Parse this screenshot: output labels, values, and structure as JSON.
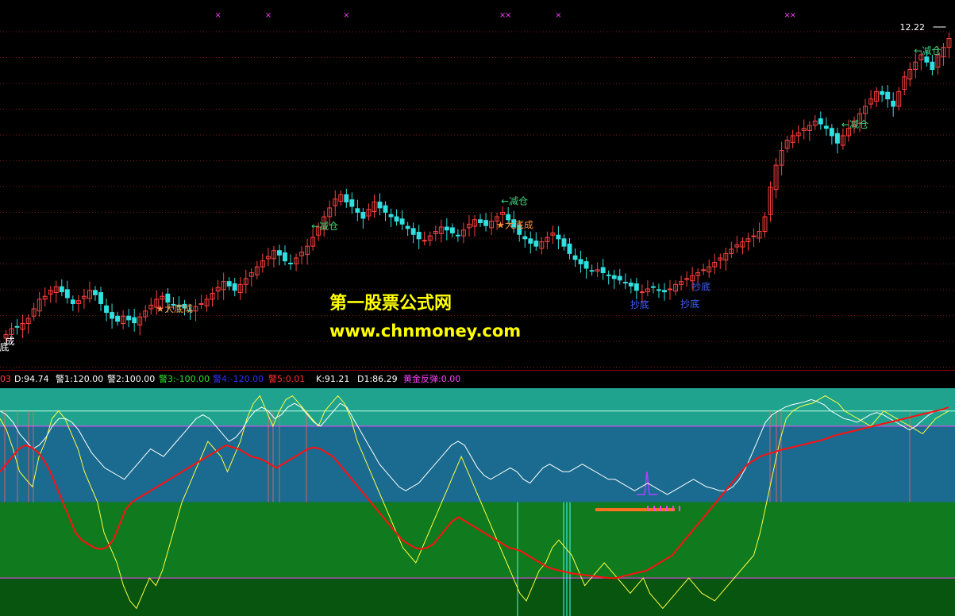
{
  "colors": {
    "background": "#000000",
    "grid": "#7a1a1a",
    "candle_up": "#ff4040",
    "candle_down": "#30e0e0",
    "signal_text": "#3cd67a",
    "star_text": "#ff9040",
    "bottom_text": "#4060ff",
    "watermark": "#ffff00",
    "zone_teal": "#1fa38f",
    "zone_blue": "#1a6b8f",
    "zone_green": "#0f7a1e",
    "zone_dark_green": "#085510",
    "kline": "#ffff40",
    "dline": "#ffffff",
    "slow_line": "#ff1010",
    "pulse": "#b040ff",
    "bar_orange": "#ff7020",
    "bar_magenta": "#ff40ff"
  },
  "watermark": {
    "line1": "第一股票公式网",
    "line2": "www.chnmoney.com"
  },
  "indicator_bar": {
    "items": [
      {
        "text": "03",
        "color": "#ff4040"
      },
      {
        "text": "D:94.74",
        "color": "#ffffff"
      },
      {
        "text": "警1:120.00",
        "color": "#ffffff"
      },
      {
        "text": "警2:100.00",
        "color": "#ffffff"
      },
      {
        "text": "警3:-100.00",
        "color": "#30e030"
      },
      {
        "text": "警4:-120.00",
        "color": "#3030ff"
      },
      {
        "text": "警5:0.01",
        "color": "#ff3030"
      },
      {
        "text": "K:91.21",
        "color": "#ffffff"
      },
      {
        "text": "D1:86.29",
        "color": "#ffffff"
      },
      {
        "text": "黄金反弹:0.00",
        "color": "#ff40ff"
      }
    ]
  },
  "chart_data": [
    {
      "type": "candlestick",
      "title": "",
      "price_label": "12.22",
      "annotations": [
        {
          "text": "底",
          "index": 0
        },
        {
          "text": "成",
          "index": 1
        },
        {
          "text": "★大底成",
          "index": 28
        },
        {
          "text": "←减仓",
          "index": 55
        },
        {
          "text": "←减仓",
          "index": 89
        },
        {
          "text": "★大底成",
          "index": 89
        },
        {
          "text": "抄底",
          "index": 113
        },
        {
          "text": "抄底",
          "index": 122
        },
        {
          "text": "抄底",
          "index": 124
        },
        {
          "text": "←减仓",
          "index": 150
        },
        {
          "text": "←减仓",
          "index": 163
        }
      ],
      "top_markers_index": [
        38,
        47,
        61,
        89,
        90,
        99,
        140,
        141
      ],
      "closes": [
        8.2,
        8.28,
        8.3,
        8.35,
        8.42,
        8.55,
        8.68,
        8.72,
        8.8,
        8.85,
        8.78,
        8.7,
        8.62,
        8.66,
        8.72,
        8.8,
        8.74,
        8.62,
        8.5,
        8.42,
        8.38,
        8.45,
        8.4,
        8.36,
        8.44,
        8.52,
        8.6,
        8.68,
        8.72,
        8.64,
        8.6,
        8.58,
        8.56,
        8.52,
        8.58,
        8.62,
        8.68,
        8.76,
        8.84,
        8.92,
        8.86,
        8.8,
        8.88,
        8.96,
        9.04,
        9.12,
        9.2,
        9.26,
        9.34,
        9.28,
        9.2,
        9.16,
        9.24,
        9.32,
        9.4,
        9.52,
        9.66,
        9.8,
        9.92,
        10.04,
        10.1,
        10.0,
        9.94,
        9.86,
        9.78,
        9.9,
        10.0,
        9.92,
        9.86,
        9.8,
        9.74,
        9.7,
        9.64,
        9.56,
        9.5,
        9.48,
        9.54,
        9.6,
        9.66,
        9.62,
        9.58,
        9.54,
        9.62,
        9.7,
        9.76,
        9.72,
        9.68,
        9.74,
        9.8,
        9.86,
        9.76,
        9.66,
        9.56,
        9.5,
        9.44,
        9.4,
        9.46,
        9.52,
        9.58,
        9.5,
        9.4,
        9.3,
        9.22,
        9.16,
        9.1,
        9.06,
        9.08,
        9.04,
        9.0,
        8.96,
        8.94,
        8.9,
        8.86,
        8.8,
        8.78,
        8.82,
        8.84,
        8.8,
        8.78,
        8.82,
        8.88,
        8.92,
        8.96,
        9.0,
        9.04,
        9.08,
        9.12,
        9.18,
        9.24,
        9.3,
        9.36,
        9.42,
        9.46,
        9.5,
        9.54,
        9.6,
        9.8,
        10.2,
        10.5,
        10.7,
        10.84,
        10.9,
        10.94,
        11.0,
        11.04,
        11.1,
        11.06,
        11.0,
        10.9,
        10.8,
        10.9,
        11.0,
        11.1,
        11.2,
        11.3,
        11.4,
        11.5,
        11.46,
        11.4,
        11.3,
        11.5,
        11.7,
        11.8,
        11.9,
        12.0,
        11.9,
        11.8,
        12.0,
        12.1,
        12.22
      ]
    },
    {
      "type": "line",
      "title": "",
      "ylim": [
        -150,
        150
      ],
      "zones": [
        {
          "from": 100,
          "to": 150,
          "color": "#1fa38f"
        },
        {
          "from": 0,
          "to": 100,
          "color": "#1a6b8f"
        },
        {
          "from": -100,
          "to": 0,
          "color": "#0f7a1e"
        },
        {
          "from": -150,
          "to": -100,
          "color": "#085510"
        }
      ],
      "series": [
        {
          "color": "#ffff40",
          "values": [
            110,
            95,
            70,
            40,
            30,
            20,
            60,
            80,
            110,
            120,
            110,
            90,
            70,
            40,
            20,
            0,
            -40,
            -60,
            -80,
            -110,
            -130,
            -140,
            -120,
            -100,
            -110,
            -90,
            -60,
            -30,
            0,
            20,
            40,
            60,
            80,
            70,
            60,
            40,
            60,
            80,
            110,
            130,
            140,
            120,
            100,
            120,
            135,
            140,
            130,
            120,
            110,
            100,
            120,
            130,
            140,
            130,
            110,
            80,
            60,
            40,
            20,
            0,
            -20,
            -40,
            -60,
            -70,
            -80,
            -60,
            -40,
            -20,
            0,
            20,
            40,
            60,
            40,
            20,
            0,
            -20,
            -40,
            -60,
            -80,
            -100,
            -120,
            -130,
            -110,
            -90,
            -80,
            -60,
            -50,
            -60,
            -70,
            -90,
            -110,
            -100,
            -90,
            -80,
            -90,
            -100,
            -110,
            -120,
            -110,
            -100,
            -120,
            -130,
            -140,
            -130,
            -120,
            -110,
            -100,
            -110,
            -120,
            -125,
            -130,
            -120,
            -110,
            -100,
            -90,
            -80,
            -70,
            -40,
            0,
            40,
            80,
            110,
            120,
            125,
            128,
            130,
            135,
            140,
            135,
            130,
            120,
            115,
            110,
            105,
            100,
            110,
            120,
            115,
            110,
            105,
            100,
            95,
            90,
            100,
            110,
            115,
            120
          ]
        },
        {
          "color": "#ffffff",
          "values": [
            120,
            115,
            105,
            90,
            80,
            70,
            75,
            85,
            100,
            110,
            110,
            105,
            95,
            80,
            65,
            55,
            45,
            40,
            35,
            30,
            40,
            50,
            60,
            70,
            65,
            60,
            70,
            80,
            90,
            100,
            110,
            115,
            110,
            100,
            90,
            80,
            85,
            95,
            110,
            120,
            125,
            120,
            110,
            115,
            125,
            130,
            125,
            115,
            105,
            100,
            110,
            120,
            130,
            125,
            110,
            95,
            80,
            65,
            50,
            40,
            30,
            20,
            15,
            20,
            25,
            35,
            45,
            55,
            65,
            75,
            80,
            75,
            60,
            45,
            35,
            30,
            35,
            40,
            45,
            40,
            30,
            25,
            35,
            45,
            50,
            45,
            40,
            40,
            45,
            50,
            45,
            40,
            35,
            30,
            30,
            25,
            20,
            15,
            20,
            25,
            20,
            15,
            10,
            15,
            20,
            25,
            30,
            25,
            20,
            18,
            15,
            15,
            20,
            30,
            45,
            65,
            85,
            105,
            115,
            120,
            125,
            128,
            130,
            132,
            135,
            132,
            128,
            120,
            115,
            110,
            108,
            105,
            110,
            115,
            118,
            115,
            110,
            105,
            100,
            95,
            100,
            108,
            115,
            120,
            122,
            125
          ]
        },
        {
          "color": "#ff1010",
          "values": [
            40,
            50,
            60,
            70,
            75,
            72,
            66,
            55,
            40,
            20,
            0,
            -20,
            -40,
            -50,
            -55,
            -60,
            -62,
            -60,
            -50,
            -30,
            -10,
            0,
            5,
            10,
            15,
            20,
            25,
            30,
            35,
            40,
            45,
            50,
            55,
            60,
            65,
            70,
            75,
            72,
            70,
            65,
            60,
            58,
            55,
            50,
            45,
            50,
            55,
            60,
            65,
            70,
            72,
            70,
            65,
            60,
            50,
            40,
            30,
            20,
            10,
            0,
            -10,
            -20,
            -30,
            -40,
            -50,
            -55,
            -60,
            -62,
            -60,
            -55,
            -45,
            -35,
            -25,
            -20,
            -25,
            -30,
            -35,
            -40,
            -45,
            -50,
            -55,
            -60,
            -62,
            -65,
            -70,
            -75,
            -80,
            -85,
            -88,
            -90,
            -92,
            -94,
            -95,
            -96,
            -97,
            -98,
            -99,
            -100,
            -100,
            -98,
            -96,
            -94,
            -92,
            -90,
            -85,
            -80,
            -75,
            -70,
            -60,
            -50,
            -40,
            -30,
            -20,
            -10,
            0,
            10,
            20,
            30,
            40,
            50,
            55,
            60,
            63,
            65,
            68,
            70,
            72,
            74,
            76,
            78,
            80,
            82,
            85,
            88,
            90,
            92,
            94,
            96,
            98,
            100,
            102,
            104,
            106,
            108,
            110,
            112,
            114,
            116,
            118,
            120,
            122,
            125
          ]
        }
      ]
    }
  ]
}
